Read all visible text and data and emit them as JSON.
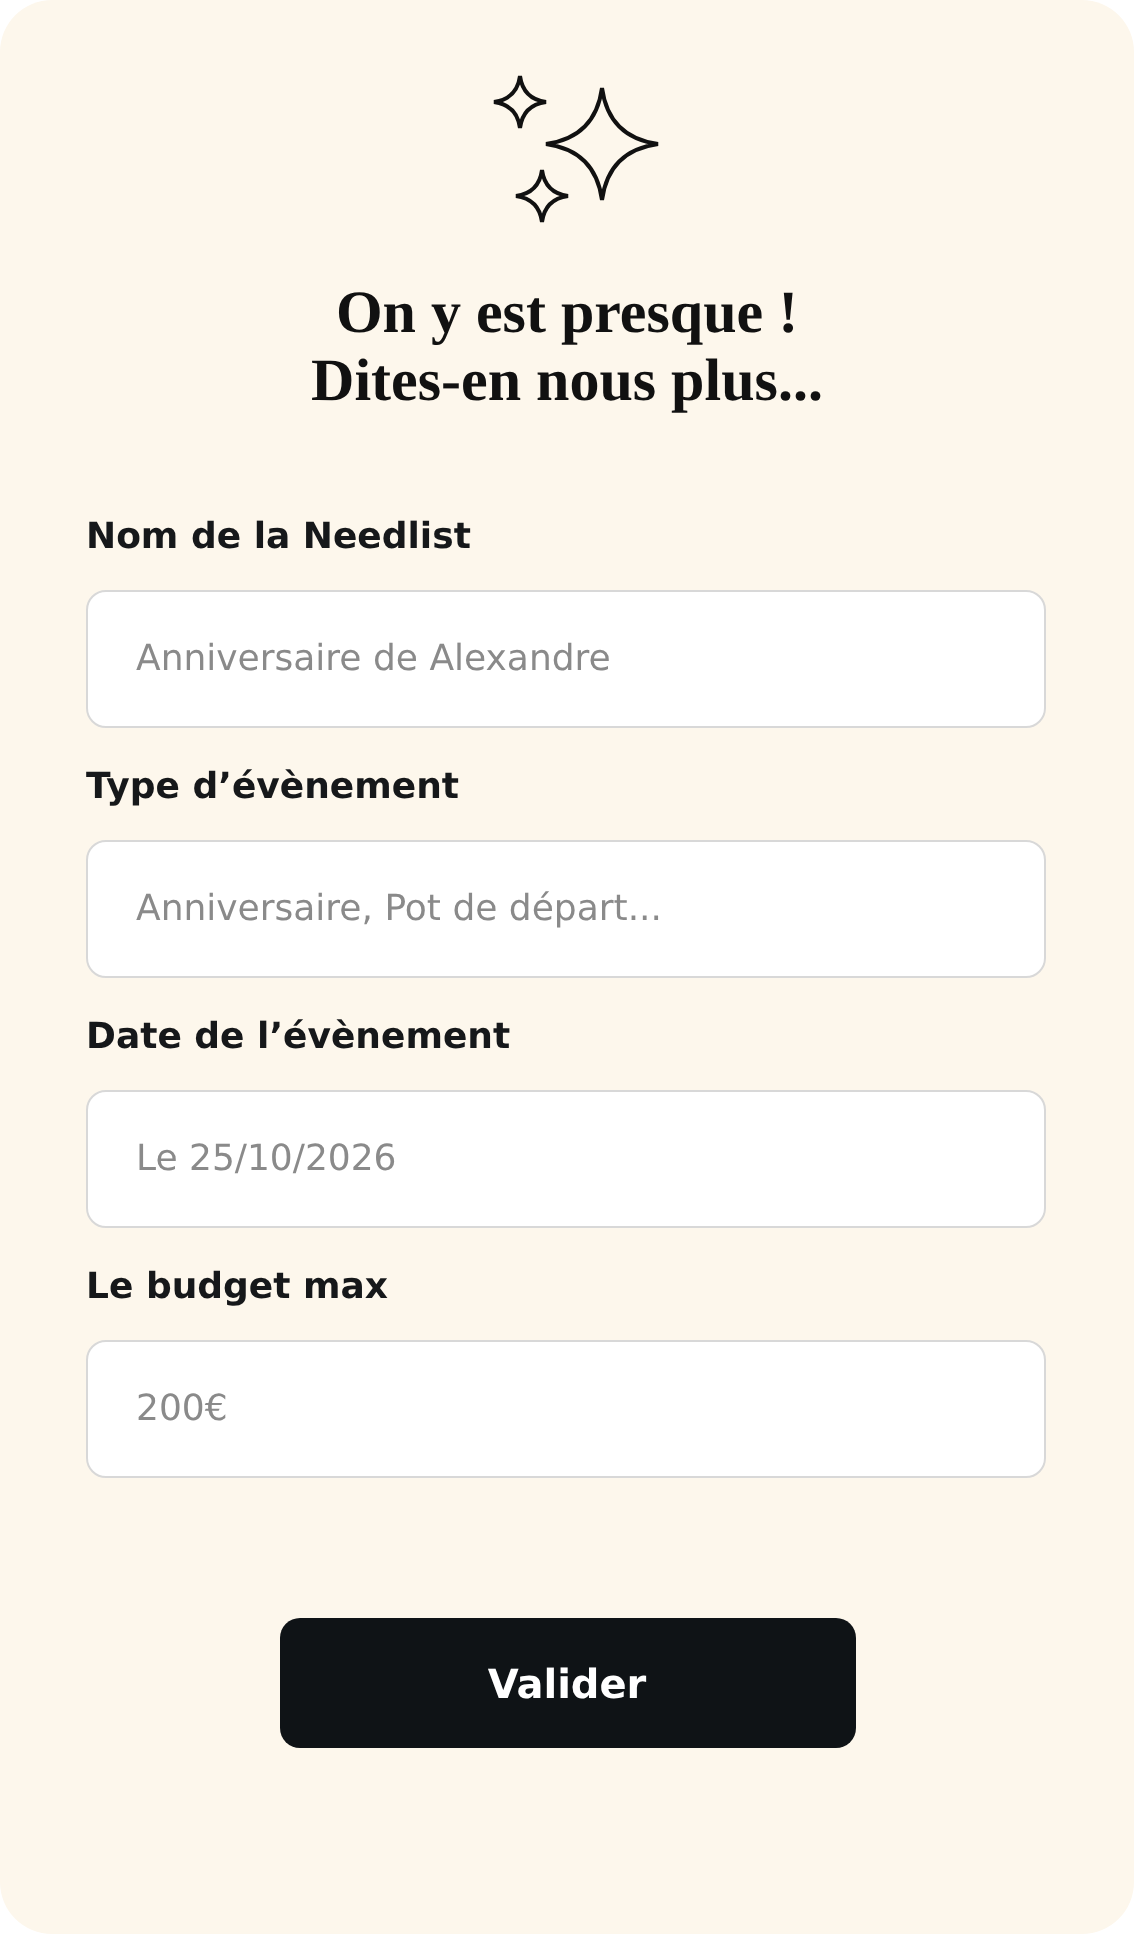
{
  "heading": [
    "On y est presque !",
    "Dites-en nous plus..."
  ],
  "fields": [
    {
      "label": "Nom de la Needlist",
      "placeholder": "Anniversaire de Alexandre"
    },
    {
      "label": "Type d’évènement",
      "placeholder": "Anniversaire, Pot de départ..."
    },
    {
      "label": "Date de l’évènement",
      "placeholder": "Le 25/10/2026"
    },
    {
      "label": "Le budget max",
      "placeholder": "200€"
    }
  ],
  "submit": "Valider"
}
